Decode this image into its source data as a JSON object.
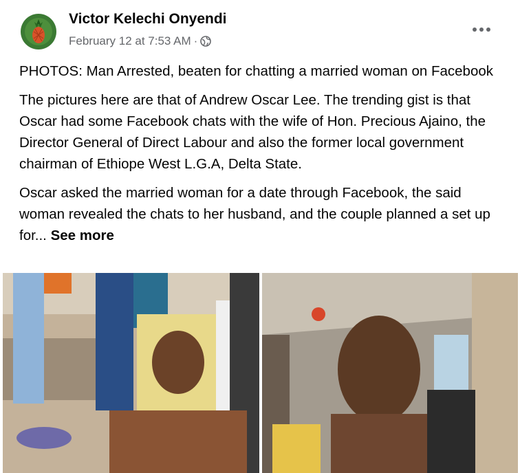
{
  "post": {
    "author": "Victor Kelechi Onyendi",
    "date": "February 12 at 7:53 AM",
    "separator": "·",
    "privacy_icon": "globe-icon",
    "menu_icon": "more-options-icon",
    "title_line": "PHOTOS: Man Arrested, beaten for chatting a married woman on Facebook",
    "paragraph1": "The pictures here are that of Andrew Oscar Lee. The trending gist is that Oscar had some Facebook chats with the wife of Hon. Precious Ajaino, the Director General of Direct Labour and also the former local government chairman of Ethiope West L.G.A, Delta State.",
    "paragraph2": "Oscar asked the married woman for a date through Facebook, the said woman revealed the chats to her husband, and the couple planned a set up for...",
    "see_more": "See more"
  },
  "colors": {
    "text": "#050505",
    "secondary": "#65676b",
    "avatar_bg": "#2f6b2a"
  }
}
